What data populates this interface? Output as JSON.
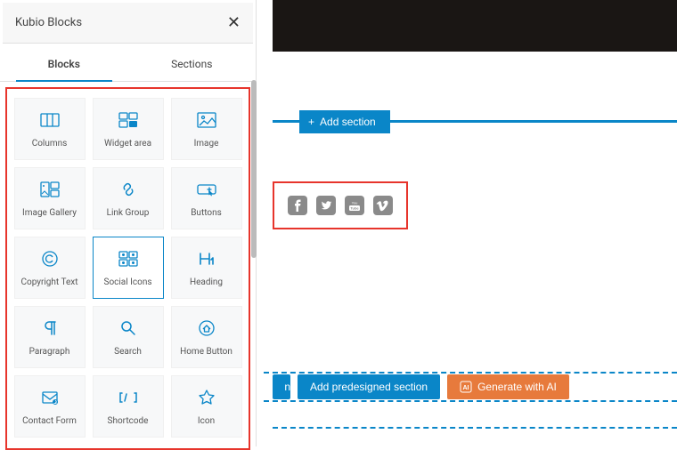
{
  "panel": {
    "title": "Kubio Blocks"
  },
  "tabs": {
    "blocks": "Blocks",
    "sections": "Sections"
  },
  "blocks": [
    {
      "id": "columns",
      "label": "Columns"
    },
    {
      "id": "widget-area",
      "label": "Widget area"
    },
    {
      "id": "image",
      "label": "Image"
    },
    {
      "id": "image-gallery",
      "label": "Image Gallery"
    },
    {
      "id": "link-group",
      "label": "Link Group"
    },
    {
      "id": "buttons",
      "label": "Buttons"
    },
    {
      "id": "copyright-text",
      "label": "Copyright Text"
    },
    {
      "id": "social-icons",
      "label": "Social Icons",
      "selected": true
    },
    {
      "id": "heading",
      "label": "Heading"
    },
    {
      "id": "paragraph",
      "label": "Paragraph"
    },
    {
      "id": "search",
      "label": "Search"
    },
    {
      "id": "home-button",
      "label": "Home Button"
    },
    {
      "id": "contact-form",
      "label": "Contact Form"
    },
    {
      "id": "shortcode",
      "label": "Shortcode"
    },
    {
      "id": "icon",
      "label": "Icon"
    }
  ],
  "canvas": {
    "add_section": "Add section",
    "add_predesigned": "Add predesigned section",
    "generate_ai": "Generate with AI",
    "partial_btn": "n"
  },
  "social_icons": [
    "facebook",
    "twitter",
    "youtube",
    "vimeo"
  ],
  "colors": {
    "accent": "#0a86c8",
    "highlight": "#e7352c",
    "orange": "#e77a3c"
  }
}
